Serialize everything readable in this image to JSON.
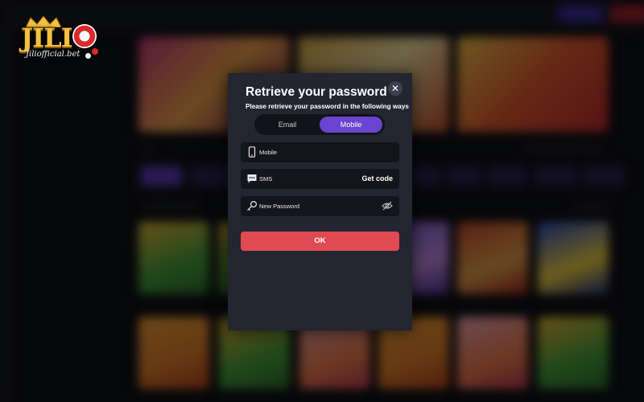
{
  "logo": {
    "name": "JILI",
    "tagline": "Jiliofficial.bet"
  },
  "modal": {
    "title": "Retrieve your password",
    "subtitle": "Please retrieve your password in the following ways",
    "tabs": [
      {
        "label": "Email",
        "active": false
      },
      {
        "label": "Mobile",
        "active": true
      }
    ],
    "fields": {
      "mobile": {
        "placeholder": "Mobile",
        "icon": "phone-icon"
      },
      "sms": {
        "placeholder": "SMS",
        "icon": "sms-icon",
        "action_label": "Get code"
      },
      "new_password": {
        "placeholder": "New Password",
        "icon": "key-icon",
        "toggle_icon": "eye-off-icon"
      }
    },
    "submit_label": "OK",
    "close_icon": "close-icon"
  },
  "colors": {
    "accent": "#6a44cf",
    "submit": "#e04a52",
    "modal_bg": "#232530",
    "field_bg": "#14151b",
    "logo_gold": "#f3c13b"
  }
}
